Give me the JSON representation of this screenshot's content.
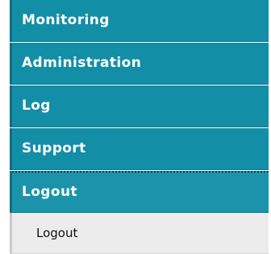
{
  "nav": {
    "items": [
      {
        "label": "Monitoring"
      },
      {
        "label": "Administration"
      },
      {
        "label": "Log"
      },
      {
        "label": "Support"
      },
      {
        "label": "Logout"
      }
    ],
    "submenu": [
      {
        "label": "Logout"
      }
    ]
  },
  "colors": {
    "menu_bg": "#138ea7",
    "menu_text": "#ffffff",
    "submenu_bg": "#ececec",
    "submenu_text": "#111111"
  }
}
